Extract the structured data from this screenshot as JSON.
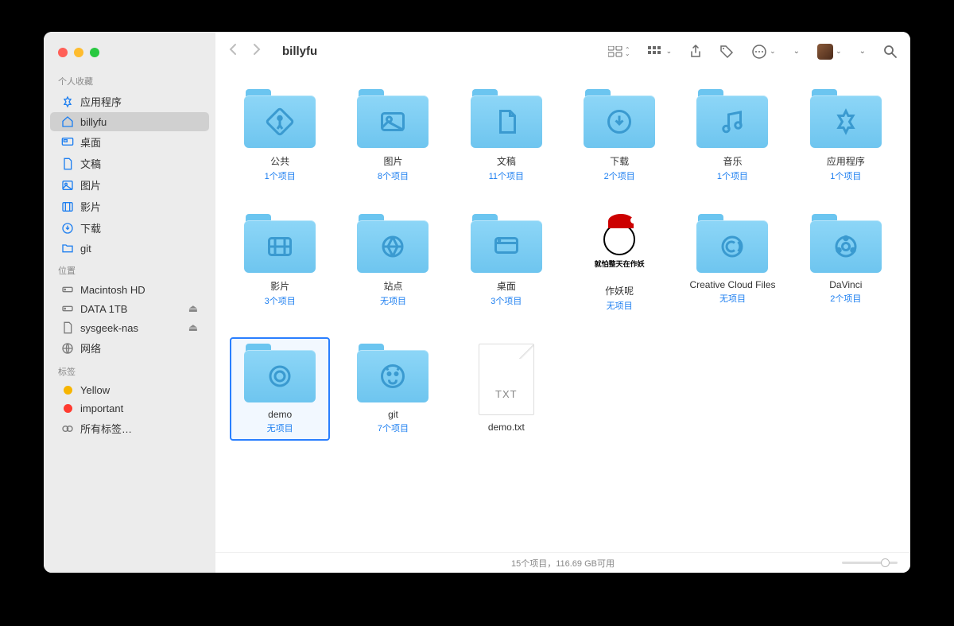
{
  "window_title": "billyfu",
  "sidebar": {
    "sections": [
      {
        "header": "个人收藏",
        "items": [
          {
            "icon": "app",
            "label": "应用程序"
          },
          {
            "icon": "home",
            "label": "billyfu",
            "selected": true
          },
          {
            "icon": "desktop",
            "label": "桌面"
          },
          {
            "icon": "doc",
            "label": "文稿"
          },
          {
            "icon": "image",
            "label": "图片"
          },
          {
            "icon": "movie",
            "label": "影片"
          },
          {
            "icon": "download",
            "label": "下载"
          },
          {
            "icon": "folder",
            "label": "git"
          }
        ]
      },
      {
        "header": "位置",
        "items": [
          {
            "icon": "hdd",
            "label": "Macintosh HD",
            "gray": true
          },
          {
            "icon": "hdd",
            "label": "DATA 1TB",
            "gray": true,
            "eject": true
          },
          {
            "icon": "doc",
            "label": "sysgeek-nas",
            "gray": true,
            "eject": true
          },
          {
            "icon": "globe",
            "label": "网络",
            "gray": true
          }
        ]
      },
      {
        "header": "标签",
        "items": [
          {
            "tagcolor": "#f7b500",
            "label": "Yellow"
          },
          {
            "tagcolor": "#ff3b30",
            "label": "important"
          },
          {
            "icon": "alltags",
            "label": "所有标签…",
            "gray": true
          }
        ]
      }
    ]
  },
  "items": [
    {
      "type": "folder",
      "glyph": "public",
      "name": "公共",
      "sub": "1个项目"
    },
    {
      "type": "folder",
      "glyph": "image",
      "name": "图片",
      "sub": "8个项目"
    },
    {
      "type": "folder",
      "glyph": "doc",
      "name": "文稿",
      "sub": "11个项目"
    },
    {
      "type": "folder",
      "glyph": "download",
      "name": "下载",
      "sub": "2个项目"
    },
    {
      "type": "folder",
      "glyph": "music",
      "name": "音乐",
      "sub": "1个项目"
    },
    {
      "type": "folder",
      "glyph": "app",
      "name": "应用程序",
      "sub": "1个项目"
    },
    {
      "type": "folder",
      "glyph": "movie",
      "name": "影片",
      "sub": "3个项目"
    },
    {
      "type": "folder",
      "glyph": "site",
      "name": "站点",
      "sub": "无项目"
    },
    {
      "type": "folder",
      "glyph": "desktop",
      "name": "桌面",
      "sub": "3个项目"
    },
    {
      "type": "meme",
      "meme_text": "就怕整天在作妖",
      "name": "作妖呢",
      "sub": "无项目"
    },
    {
      "type": "folder",
      "glyph": "cc",
      "name": "Creative Cloud Files",
      "sub": "无项目"
    },
    {
      "type": "folder",
      "glyph": "davinci",
      "name": "DaVinci",
      "sub": "2个项目"
    },
    {
      "type": "folder",
      "glyph": "demo",
      "name": "demo",
      "sub": "无项目",
      "selected": true
    },
    {
      "type": "folder",
      "glyph": "github",
      "name": "git",
      "sub": "7个项目"
    },
    {
      "type": "txt",
      "badge": "TXT",
      "name": "demo.txt",
      "sub": ""
    }
  ],
  "status": "15个项目，116.69 GB可用"
}
